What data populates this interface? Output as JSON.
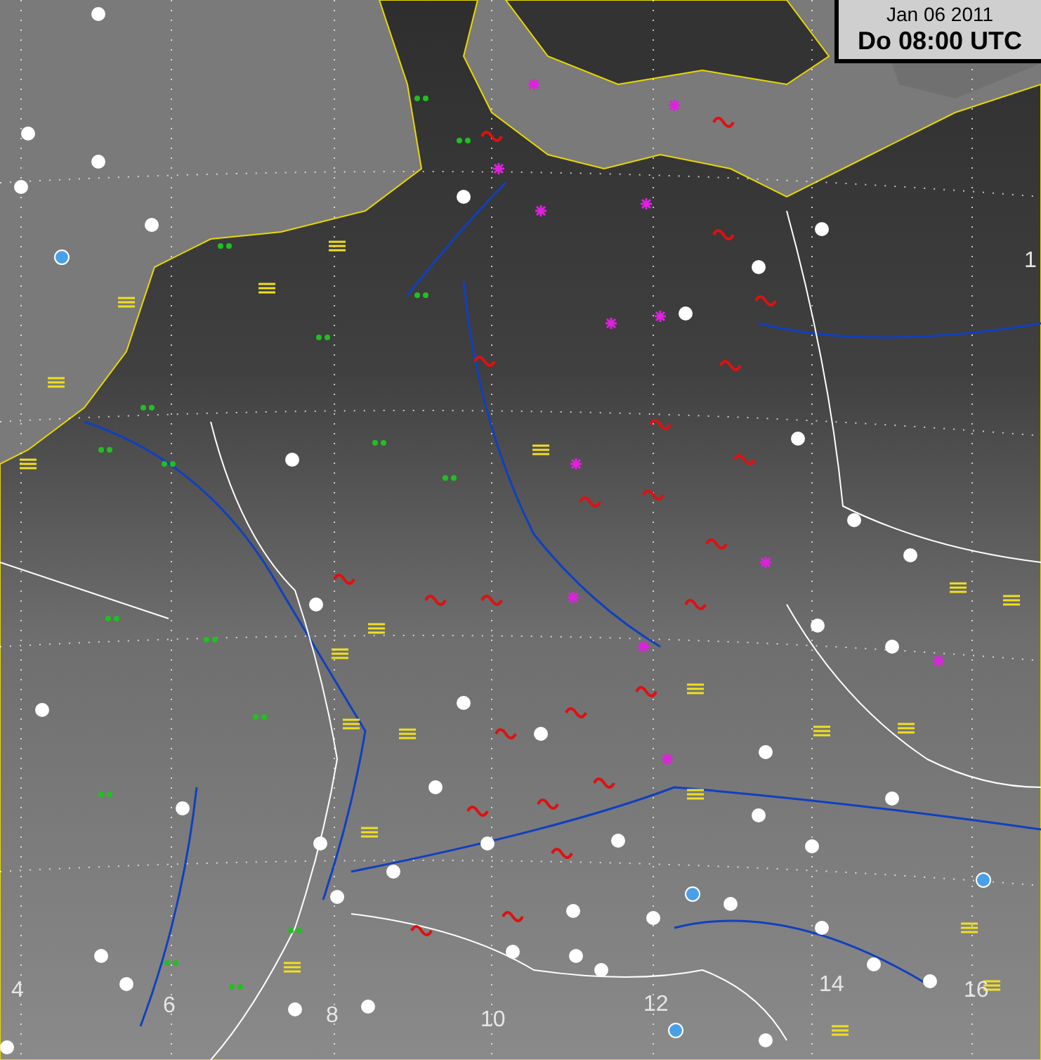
{
  "timestamp": {
    "date": "Jan 06 2011",
    "time": "Do 08:00 UTC"
  },
  "map": {
    "longitude_labels": [
      "4",
      "6",
      "8",
      "10",
      "12",
      "14",
      "16"
    ],
    "edge_label": "1"
  }
}
